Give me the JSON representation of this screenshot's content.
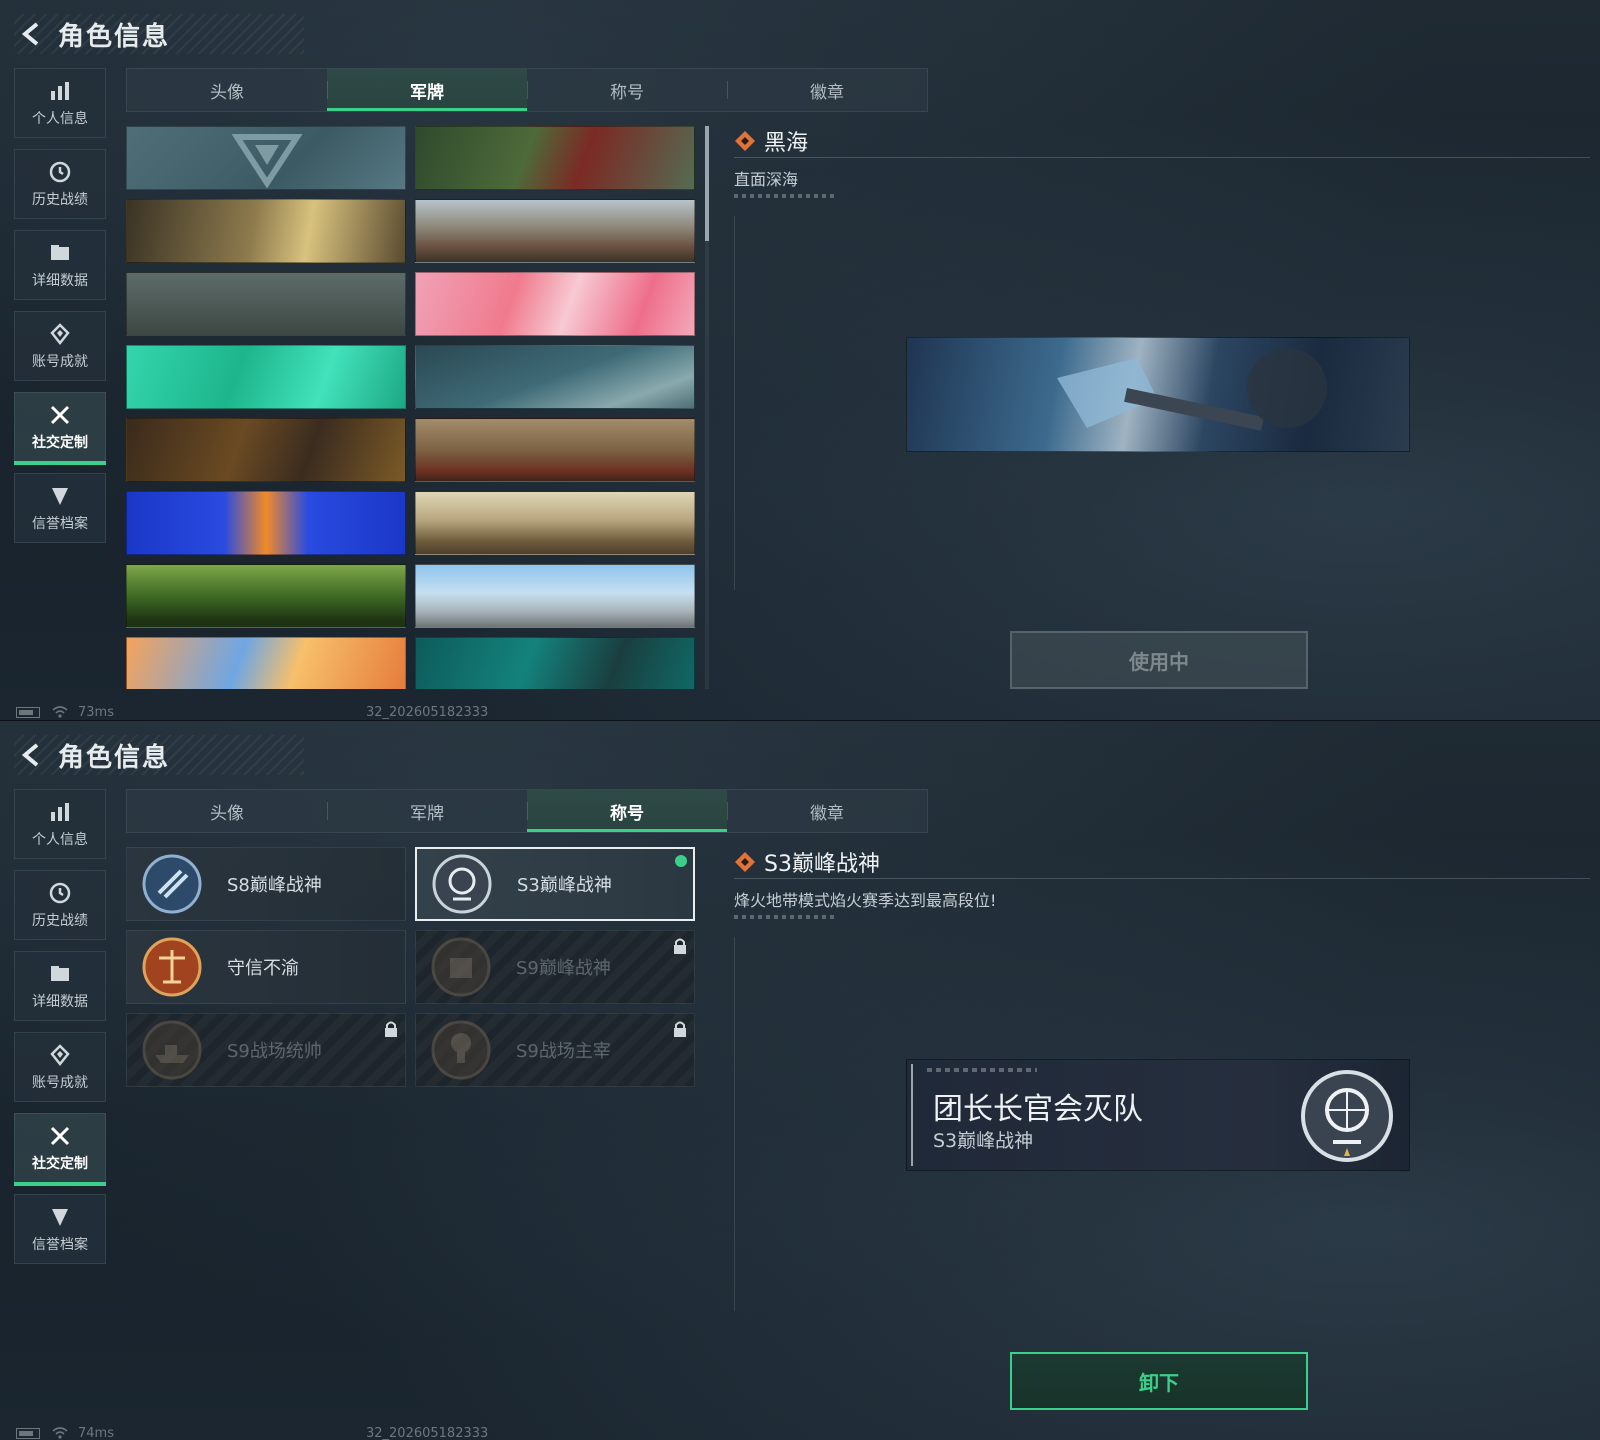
{
  "header": {
    "title": "角色信息"
  },
  "sidebar": {
    "items": [
      {
        "label": "个人信息",
        "icon": "bar-chart-icon"
      },
      {
        "label": "历史战绩",
        "icon": "clock-icon"
      },
      {
        "label": "详细数据",
        "icon": "folder-icon"
      },
      {
        "label": "账号成就",
        "icon": "diamond-icon"
      },
      {
        "label": "社交定制",
        "icon": "tools-icon",
        "active": true
      },
      {
        "label": "信誉档案",
        "icon": "shield-icon"
      }
    ]
  },
  "tabs": [
    "头像",
    "军牌",
    "称号",
    "徽章"
  ],
  "panel_a": {
    "active_tab": "军牌",
    "selected": {
      "name": "黑海",
      "description": "直面深海"
    },
    "button": "使用中",
    "status": {
      "latency": "73ms",
      "build": "32_202605182333"
    }
  },
  "panel_b": {
    "active_tab": "称号",
    "titles": [
      {
        "name": "S8巅峰战神",
        "locked": false
      },
      {
        "name": "S3巅峰战神",
        "locked": false,
        "selected": true,
        "equipped": true
      },
      {
        "name": "守信不渝",
        "locked": false
      },
      {
        "name": "S9巅峰战神",
        "locked": true
      },
      {
        "name": "S9战场统帅",
        "locked": true
      },
      {
        "name": "S9战场主宰",
        "locked": true
      }
    ],
    "selected": {
      "name": "S3巅峰战神",
      "description": "烽火地带模式焰火赛季达到最高段位!"
    },
    "preview_card": {
      "player": "团长长官会灭队",
      "title": "S3巅峰战神"
    },
    "button": "卸下",
    "status": {
      "latency": "74ms",
      "build": "32_202605182333"
    }
  },
  "colors": {
    "accent": "#3bd08a",
    "diamond": "#e0723a",
    "background": "#17212a"
  }
}
